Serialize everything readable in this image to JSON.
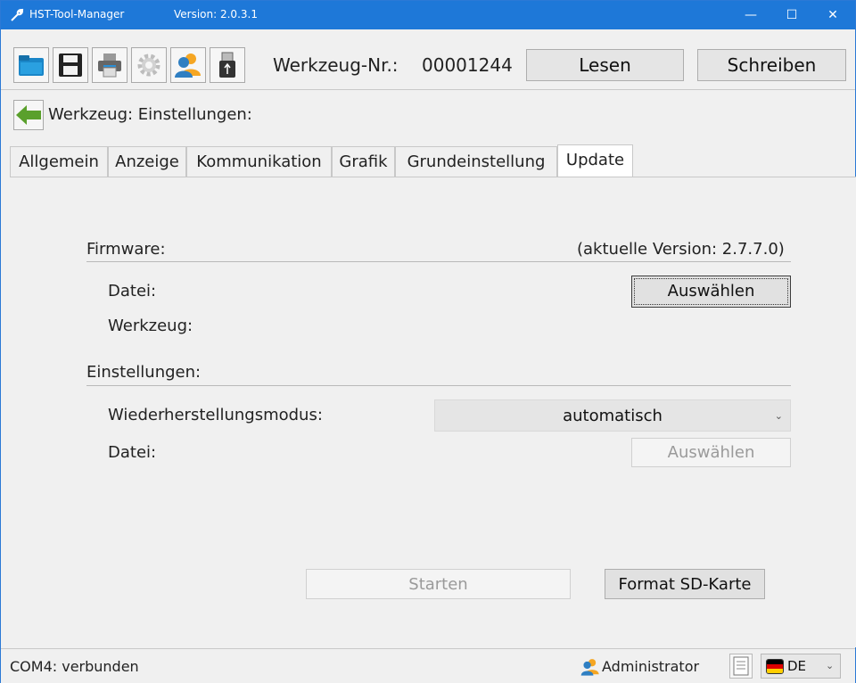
{
  "window": {
    "title": "HST-Tool-Manager",
    "version": "Version: 2.0.3.1",
    "min_icon": "minimize-icon",
    "max_icon": "maximize-icon",
    "close_icon": "close-icon"
  },
  "toolbar": {
    "icons": [
      "open-folder-icon",
      "save-icon",
      "print-icon",
      "settings-gear-icon",
      "user-icon",
      "usb-icon"
    ],
    "tool_number_label": "Werkzeug-Nr.:",
    "tool_number_value": "00001244",
    "read_label": "Lesen",
    "write_label": "Schreiben"
  },
  "breadcrumb": {
    "back_icon": "back-arrow-icon",
    "text": "Werkzeug: Einstellungen:"
  },
  "tabs": [
    {
      "label": "Allgemein",
      "active": false
    },
    {
      "label": "Anzeige",
      "active": false
    },
    {
      "label": "Kommunikation",
      "active": false
    },
    {
      "label": "Grafik",
      "active": false
    },
    {
      "label": "Grundeinstellung",
      "active": false
    },
    {
      "label": "Update",
      "active": true
    }
  ],
  "firmware": {
    "section_label": "Firmware:",
    "current_version": "(aktuelle Version:  2.7.7.0)",
    "file_label": "Datei:",
    "select_button": "Auswählen",
    "tool_label": "Werkzeug:"
  },
  "settings": {
    "section_label": "Einstellungen:",
    "restore_mode_label": "Wiederherstellungsmodus:",
    "restore_mode_value": "automatisch",
    "file_label": "Datei:",
    "select_button": "Auswählen"
  },
  "actions": {
    "start_button": "Starten",
    "format_button": "Format SD-Karte"
  },
  "statusbar": {
    "connection": "COM4: verbunden",
    "user": "Administrator",
    "language": "DE"
  },
  "colors": {
    "titlebar": "#1e78d8",
    "accent_green": "#5aa02c",
    "user_orange": "#f5a623",
    "user_blue": "#2f7fc2"
  }
}
